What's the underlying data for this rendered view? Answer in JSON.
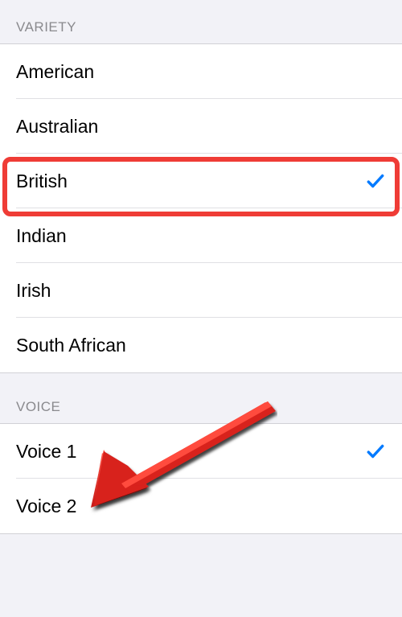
{
  "sections": {
    "variety": {
      "header": "Variety",
      "items": [
        {
          "label": "American",
          "selected": false
        },
        {
          "label": "Australian",
          "selected": false
        },
        {
          "label": "British",
          "selected": true
        },
        {
          "label": "Indian",
          "selected": false
        },
        {
          "label": "Irish",
          "selected": false
        },
        {
          "label": "South African",
          "selected": false
        }
      ]
    },
    "voice": {
      "header": "Voice",
      "items": [
        {
          "label": "Voice 1",
          "selected": true
        },
        {
          "label": "Voice 2",
          "selected": false
        }
      ]
    }
  }
}
